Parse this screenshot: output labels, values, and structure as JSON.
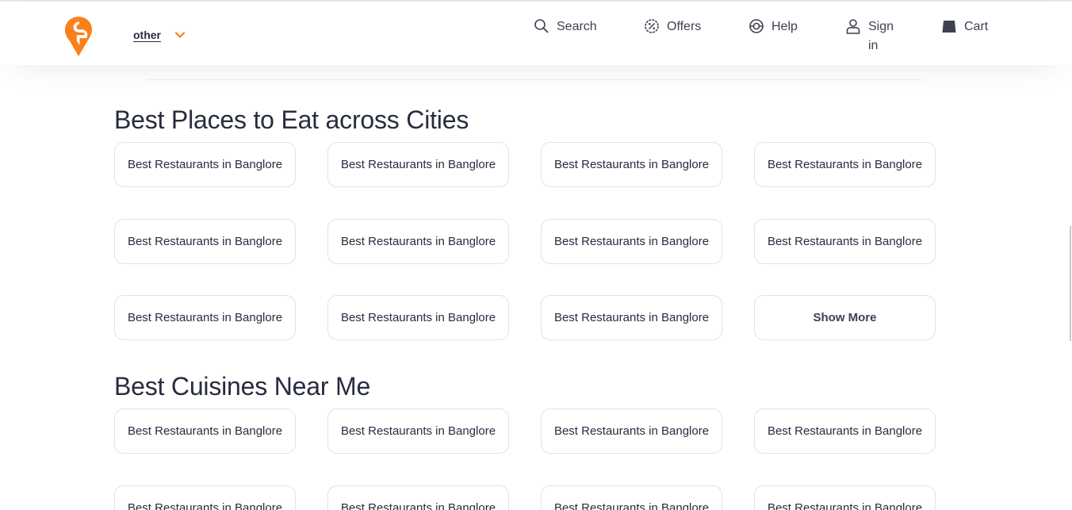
{
  "header": {
    "location": "other",
    "nav": {
      "search": "Search",
      "offers": "Offers",
      "help": "Help",
      "signin": "Sign in",
      "cart": "Cart"
    }
  },
  "colors": {
    "brand": "#fc8019",
    "text": "#282c3f",
    "border": "#e2e2e7"
  },
  "sections": [
    {
      "title": "Best Places to Eat across Cities",
      "items": [
        "Best Restaurants in Banglore",
        "Best Restaurants in Banglore",
        "Best Restaurants in Banglore",
        "Best Restaurants in Banglore",
        "Best Restaurants in Banglore",
        "Best Restaurants in Banglore",
        "Best Restaurants in Banglore",
        "Best Restaurants in Banglore",
        "Best Restaurants in Banglore",
        "Best Restaurants in Banglore",
        "Best Restaurants in Banglore",
        "Show More"
      ]
    },
    {
      "title": "Best Cuisines Near Me",
      "items": [
        "Best Restaurants in Banglore",
        "Best Restaurants in Banglore",
        "Best Restaurants in Banglore",
        "Best Restaurants in Banglore",
        "Best Restaurants in Banglore",
        "Best Restaurants in Banglore",
        "Best Restaurants in Banglore",
        "Best Restaurants in Banglore"
      ]
    }
  ]
}
